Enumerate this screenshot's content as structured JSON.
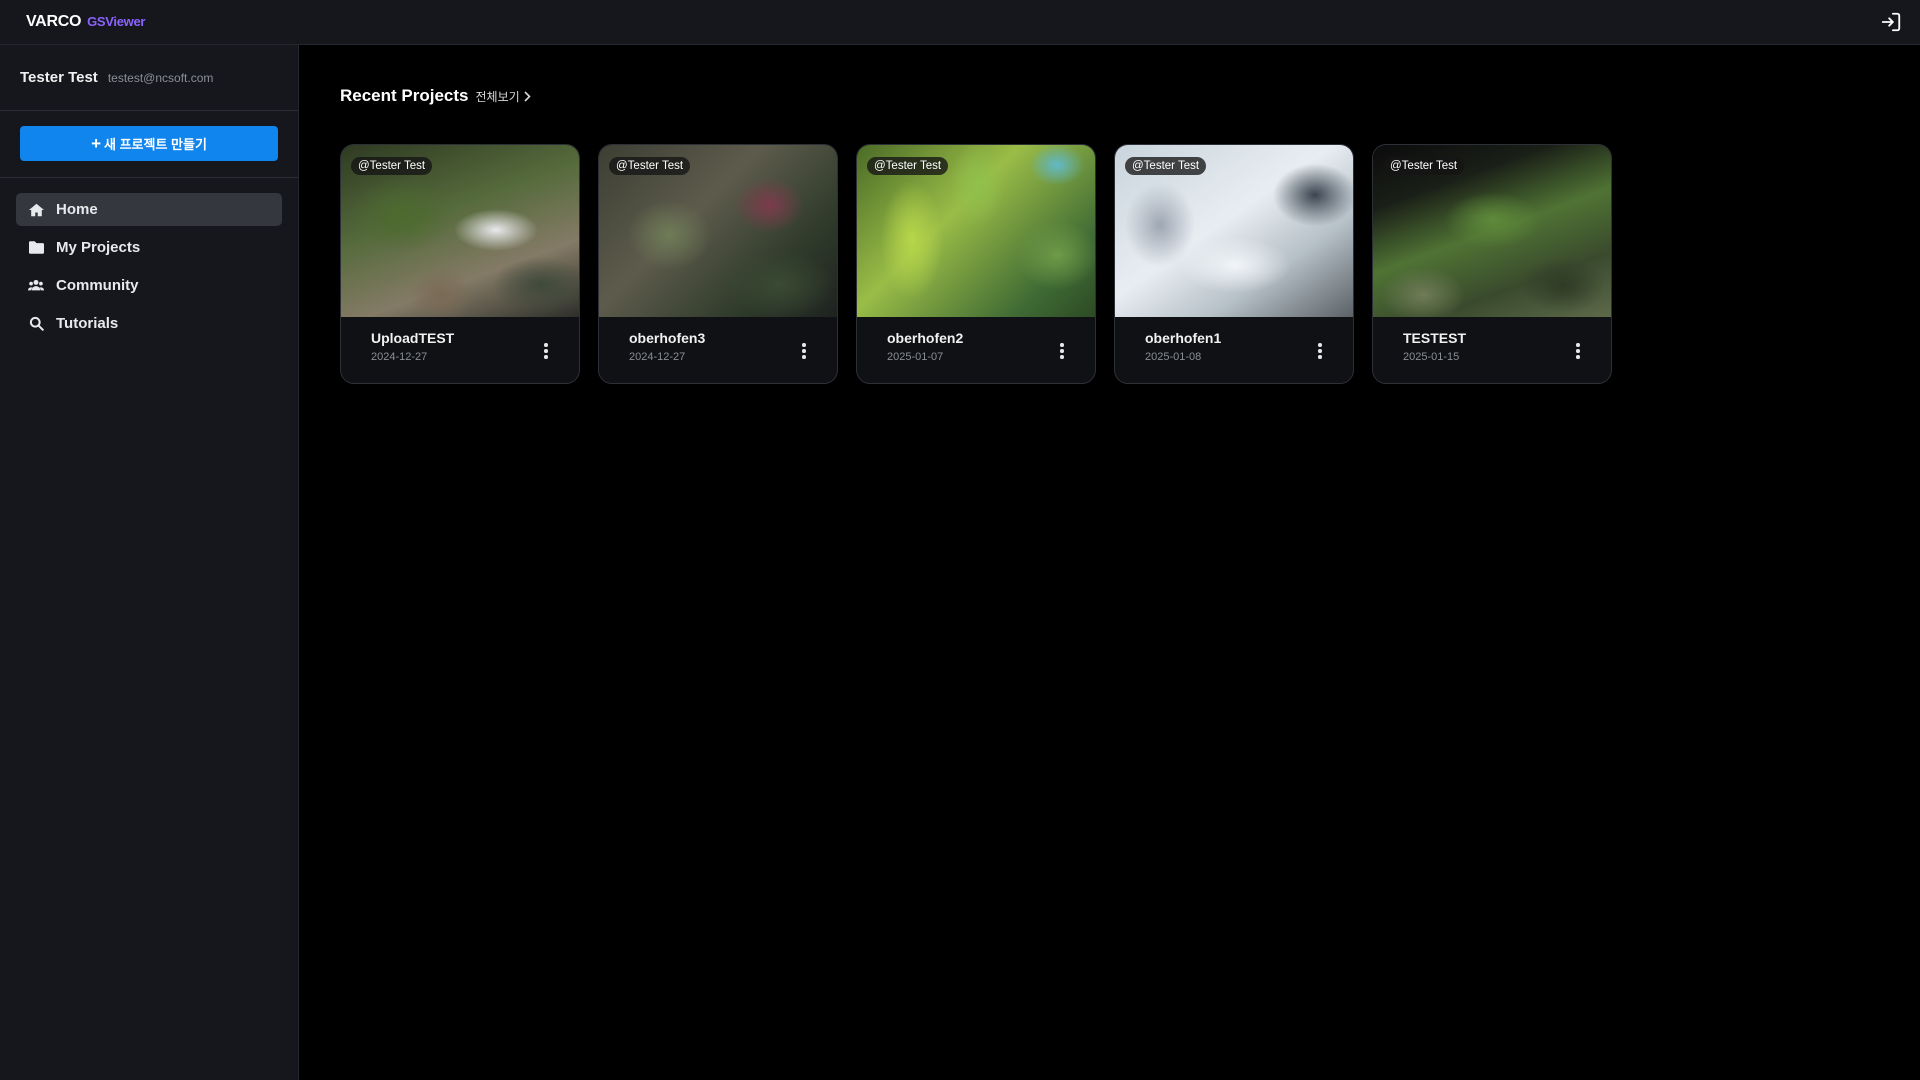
{
  "app": {
    "brand": "VARCO",
    "product": "GSViewer"
  },
  "user": {
    "name": "Tester Test",
    "email": "testest@ncsoft.com"
  },
  "sidebar": {
    "new_project_label": "새 프로젝트 만들기",
    "items": [
      {
        "label": "Home",
        "icon": "home-icon",
        "active": true
      },
      {
        "label": "My Projects",
        "icon": "folder-icon",
        "active": false
      },
      {
        "label": "Community",
        "icon": "users-icon",
        "active": false
      },
      {
        "label": "Tutorials",
        "icon": "search-icon",
        "active": false
      }
    ]
  },
  "main": {
    "section_title": "Recent Projects",
    "see_all": "전체보기",
    "projects": [
      {
        "tag": "@Tester Test",
        "title": "UploadTEST",
        "date": "2024-12-27"
      },
      {
        "tag": "@Tester Test",
        "title": "oberhofen3",
        "date": "2024-12-27"
      },
      {
        "tag": "@Tester Test",
        "title": "oberhofen2",
        "date": "2025-01-07"
      },
      {
        "tag": "@Tester Test",
        "title": "oberhofen1",
        "date": "2025-01-08"
      },
      {
        "tag": "@Tester Test",
        "title": "TESTEST",
        "date": "2025-01-15"
      }
    ]
  },
  "colors": {
    "accent": "#1185ee",
    "brand_sub": "#8a63ff",
    "sidebar_bg": "#15171c"
  }
}
